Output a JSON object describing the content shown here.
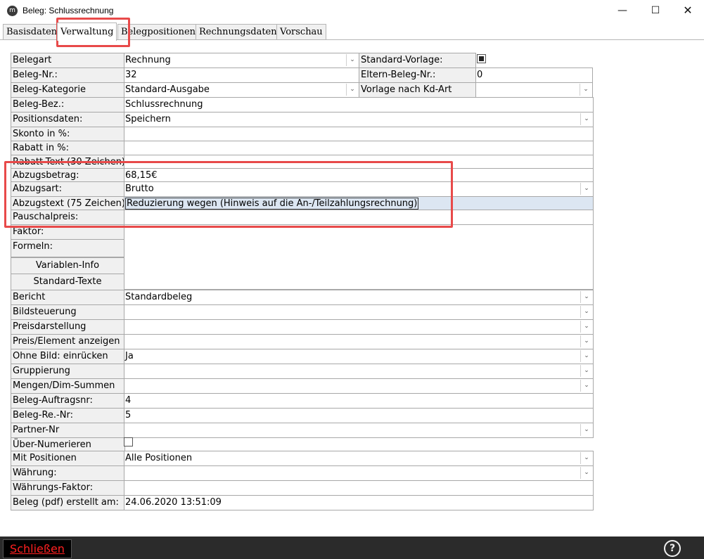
{
  "window": {
    "title": "Beleg: Schlussrechnung",
    "icon": "m"
  },
  "tabs": [
    {
      "label": "Basisdaten"
    },
    {
      "label": "Verwaltung"
    },
    {
      "label": "Belegpositionen"
    },
    {
      "label": "Rechnungsdaten"
    },
    {
      "label": "Vorschau"
    }
  ],
  "fields": {
    "belegart": {
      "label": "Belegart",
      "value": "Rechnung"
    },
    "standard_vorlage": {
      "label": "Standard-Vorlage:",
      "checked": true
    },
    "beleg_nr": {
      "label": "Beleg-Nr.:",
      "value": "32"
    },
    "eltern_beleg_nr": {
      "label": "Eltern-Beleg-Nr.:",
      "value": "0"
    },
    "beleg_kategorie": {
      "label": "Beleg-Kategorie",
      "value": "Standard-Ausgabe"
    },
    "vorlage_kd_art": {
      "label": "Vorlage nach Kd-Art",
      "value": ""
    },
    "beleg_bez": {
      "label": "Beleg-Bez.:",
      "value": "Schlussrechnung"
    },
    "positionsdaten": {
      "label": "Positionsdaten:",
      "value": "Speichern"
    },
    "skonto": {
      "label": "Skonto in %:",
      "value": ""
    },
    "rabatt": {
      "label": "Rabatt in %:",
      "value": ""
    },
    "rabatt_text": {
      "label": "Rabatt-Text (30 Zeichen):",
      "value": ""
    },
    "abzugsbetrag": {
      "label": "Abzugsbetrag:",
      "value": "68,15€"
    },
    "abzugsart": {
      "label": "Abzugsart:",
      "value": "Brutto"
    },
    "abzugstext": {
      "label": "Abzugstext (75 Zeichen):",
      "value": "Reduzierung wegen (Hinweis auf die An-/Teilzahlungsrechnung)"
    },
    "pauschalpreis": {
      "label": "Pauschalpreis:",
      "value": ""
    },
    "faktor": {
      "label": "Faktor:",
      "value": ""
    },
    "formeln": {
      "label": "Formeln:",
      "value": ""
    },
    "bericht": {
      "label": "Bericht",
      "value": "Standardbeleg"
    },
    "bildsteuerung": {
      "label": "Bildsteuerung",
      "value": ""
    },
    "preisdarstellung": {
      "label": "Preisdarstellung",
      "value": ""
    },
    "preis_element": {
      "label": "Preis/Element anzeigen",
      "value": ""
    },
    "ohne_bild": {
      "label": "Ohne Bild: einrücken",
      "value": "Ja"
    },
    "gruppierung": {
      "label": "Gruppierung",
      "value": ""
    },
    "mengen_dim": {
      "label": "Mengen/Dim-Summen",
      "value": ""
    },
    "beleg_auftragsnr": {
      "label": "Beleg-Auftragsnr:",
      "value": "4"
    },
    "beleg_re_nr": {
      "label": "Beleg-Re.-Nr:",
      "value": "5"
    },
    "partner_nr": {
      "label": "Partner-Nr",
      "value": ""
    },
    "ueber_numerieren": {
      "label": "Über-Numerieren",
      "checked": false
    },
    "mit_positionen": {
      "label": "Mit Positionen",
      "value": "Alle Positionen"
    },
    "waehrung": {
      "label": "Währung:",
      "value": ""
    },
    "waehrungs_faktor": {
      "label": "Währungs-Faktor:",
      "value": ""
    },
    "beleg_pdf": {
      "label": "Beleg (pdf) erstellt am:",
      "value": "24.06.2020 13:51:09"
    }
  },
  "buttons": {
    "variablen_info": "Variablen-Info",
    "standard_texte": "Standard-Texte"
  },
  "bottom": {
    "close_label": "Schließen",
    "help_label": "?"
  },
  "colors": {
    "highlight_box": "#e84a4a",
    "bottom_bar": "#2b2b2b",
    "close_text": "#ff2020"
  }
}
